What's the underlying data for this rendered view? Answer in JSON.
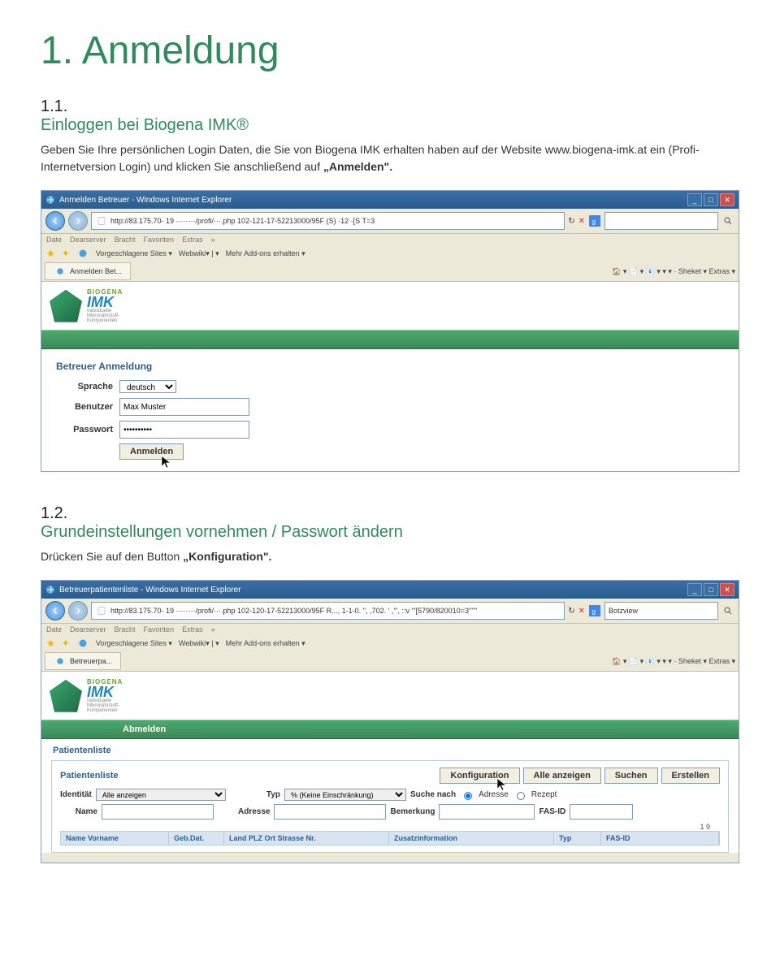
{
  "page": {
    "h1": "1.  Anmeldung"
  },
  "s1": {
    "num": "1.1.",
    "title": "Einloggen bei Biogena IMK®",
    "body_a": "Geben Sie Ihre persönlichen Login Daten, die Sie von Biogena IMK erhalten haben auf der Website www.biogena-imk.at ein (Profi-Internetversion Login) und klicken Sie anschließend auf ",
    "body_b": "„Anmelden\"."
  },
  "shot1": {
    "title": "Anmelden Betreuer - Windows Internet Explorer",
    "url": "http://83.175.70- 19 ········/profi/···.php  102-121-17-52213000/95F    (S)  ·12  ·[S   T=3",
    "menu": [
      "Date",
      "Dearserver",
      "Bracht",
      "Favoriten",
      "Extras"
    ],
    "fav_sites": "Vorgeschlagene Sites ▾",
    "fav_web": "Webwiki▾ | ▾",
    "fav_more": "Mehr Add-ons erhalten ▾",
    "tab": "Anmelden Bet...",
    "right_tools": "🏠 ▾   📄 ▾   📧 ▾   ▾ ▾   · Sheket ▾   Extras ▾",
    "brand1": "BIOGENA",
    "brand2": "IMK",
    "brand_sub1": "Individuelle",
    "brand_sub2": "Mikronährstoff-",
    "brand_sub3": "Komponenten",
    "form_title": "Betreuer Anmeldung",
    "lbl_sprache": "Sprache",
    "val_sprache": "deutsch",
    "lbl_benutzer": "Benutzer",
    "val_benutzer": "Max Muster",
    "lbl_passwort": "Passwort",
    "val_passwort": "••••••••••",
    "btn": "Anmelden"
  },
  "s2": {
    "num": "1.2.",
    "title": "Grundeinstellungen vornehmen / Passwort ändern",
    "body_a": "Drücken Sie auf den Button ",
    "body_b": "„Konfiguration\"."
  },
  "shot2": {
    "title": "Betreuerpatientenliste - Windows Internet Explorer",
    "url": "http://83.175.70- 19 ········/profi/···.php  102-120-17-52213000/95F  R...,  1-1-0. '',  ,702. '  ,''', ::v   '''[5790/820010=3''''''",
    "search_right": "Botzview",
    "tab": "Betreuerpa...",
    "abmelden": "Abmelden",
    "pane": "Patientenliste",
    "box_title": "Patientenliste",
    "btns": [
      "Konfiguration",
      "Alle anzeigen",
      "Suchen",
      "Erstellen"
    ],
    "lbl_identitat": "Identität",
    "val_identitat": "Alle anzeigen",
    "lbl_typ": "Typ",
    "val_typ": "% (Keine Einschränkung)",
    "lbl_suche": "Suche nach",
    "opt_adresse": "Adresse",
    "opt_rezept": "Rezept",
    "lbl_name": "Name",
    "lbl_adresse": "Adresse",
    "lbl_bemerkung": "Bemerkung",
    "lbl_fasid": "FAS-ID",
    "pager": "1  9",
    "th": [
      "Name Vorname",
      "Geb.Dat.",
      "Land PLZ Ort Strasse Nr.",
      "Zusatzinformation",
      "Typ",
      "FAS-ID"
    ]
  }
}
